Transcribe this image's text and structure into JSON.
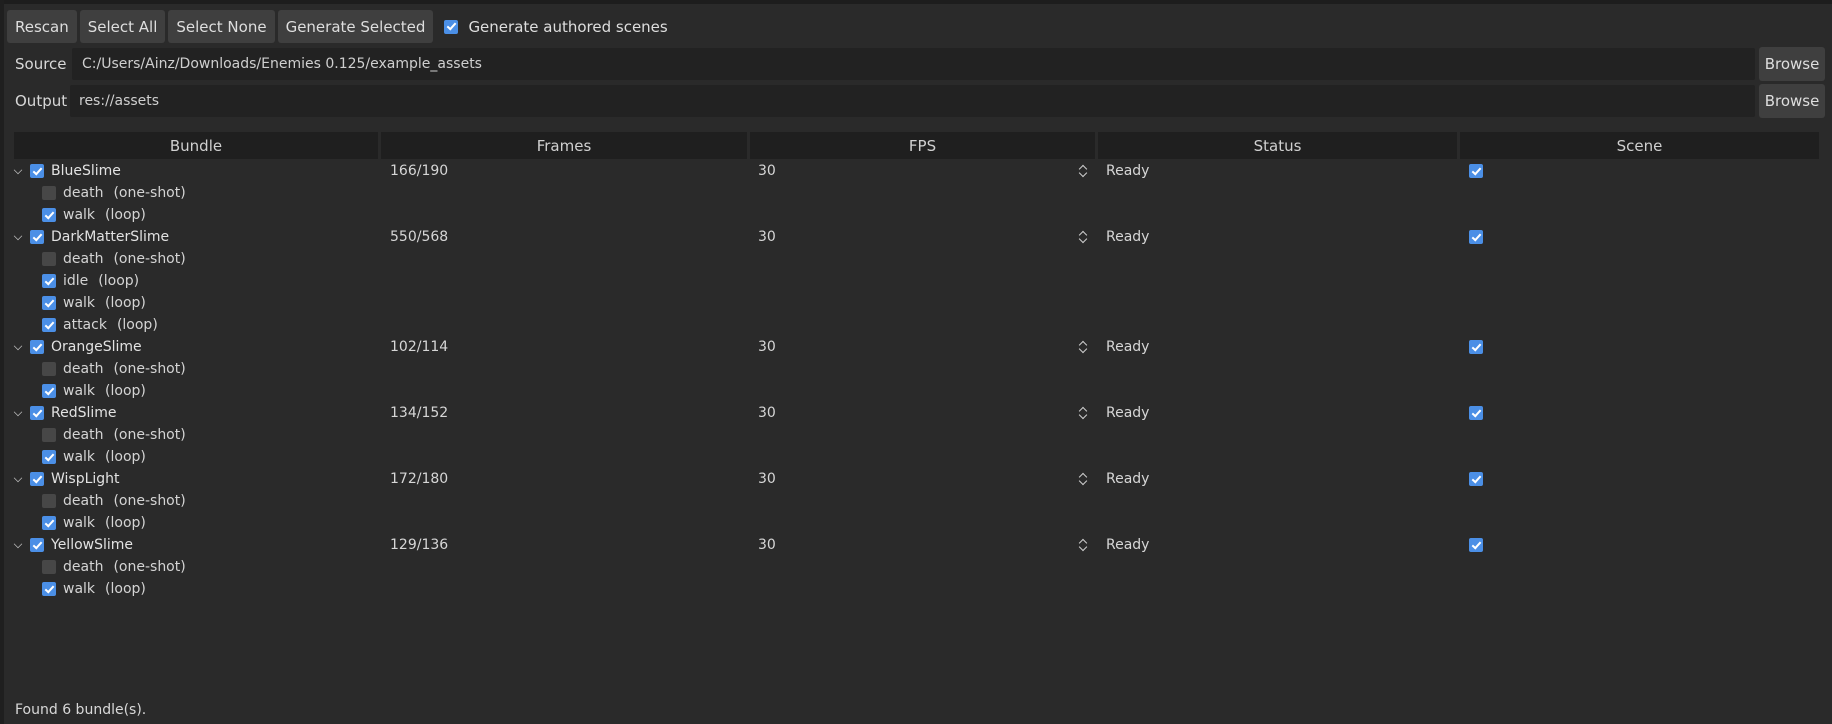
{
  "toolbar": {
    "rescan": "Rescan",
    "select_all": "Select All",
    "select_none": "Select None",
    "generate_selected": "Generate Selected",
    "generate_authored": {
      "label": "Generate authored scenes",
      "checked": true
    }
  },
  "source": {
    "label": "Source",
    "value": "C:/Users/Ainz/Downloads/Enemies 0.125/example_assets",
    "browse": "Browse"
  },
  "output": {
    "label": "Output",
    "value": "res://assets",
    "browse": "Browse"
  },
  "columns": [
    "Bundle",
    "Frames",
    "FPS",
    "Status",
    "Scene"
  ],
  "bundles": [
    {
      "name": "BlueSlime",
      "checked": true,
      "frames": "166/190",
      "fps": "30",
      "status": "Ready",
      "scene": true,
      "anims": [
        {
          "name": "death",
          "mode": "(one-shot)",
          "checked": false
        },
        {
          "name": "walk",
          "mode": "(loop)",
          "checked": true
        }
      ]
    },
    {
      "name": "DarkMatterSlime",
      "checked": true,
      "frames": "550/568",
      "fps": "30",
      "status": "Ready",
      "scene": true,
      "anims": [
        {
          "name": "death",
          "mode": "(one-shot)",
          "checked": false
        },
        {
          "name": "idle",
          "mode": "(loop)",
          "checked": true
        },
        {
          "name": "walk",
          "mode": "(loop)",
          "checked": true
        },
        {
          "name": "attack",
          "mode": "(loop)",
          "checked": true
        }
      ]
    },
    {
      "name": "OrangeSlime",
      "checked": true,
      "frames": "102/114",
      "fps": "30",
      "status": "Ready",
      "scene": true,
      "anims": [
        {
          "name": "death",
          "mode": "(one-shot)",
          "checked": false
        },
        {
          "name": "walk",
          "mode": "(loop)",
          "checked": true
        }
      ]
    },
    {
      "name": "RedSlime",
      "checked": true,
      "frames": "134/152",
      "fps": "30",
      "status": "Ready",
      "scene": true,
      "anims": [
        {
          "name": "death",
          "mode": "(one-shot)",
          "checked": false
        },
        {
          "name": "walk",
          "mode": "(loop)",
          "checked": true
        }
      ]
    },
    {
      "name": "WispLight",
      "checked": true,
      "frames": "172/180",
      "fps": "30",
      "status": "Ready",
      "scene": true,
      "anims": [
        {
          "name": "death",
          "mode": "(one-shot)",
          "checked": false
        },
        {
          "name": "walk",
          "mode": "(loop)",
          "checked": true
        }
      ]
    },
    {
      "name": "YellowSlime",
      "checked": true,
      "frames": "129/136",
      "fps": "30",
      "status": "Ready",
      "scene": true,
      "anims": [
        {
          "name": "death",
          "mode": "(one-shot)",
          "checked": false
        },
        {
          "name": "walk",
          "mode": "(loop)",
          "checked": true
        }
      ]
    }
  ],
  "footer": {
    "status_text": "Found 6 bundle(s)."
  },
  "colors": {
    "accent": "#4b8fe6",
    "background": "#2a2a2a",
    "header_bg": "#1f1f1f",
    "button_bg": "#3f3f3f",
    "input_bg": "#222222"
  }
}
